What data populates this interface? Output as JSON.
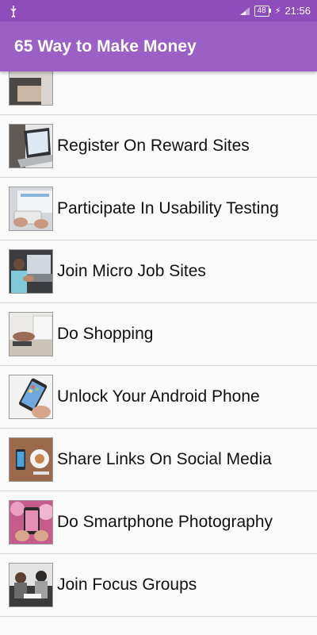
{
  "status_bar": {
    "battery": "48",
    "time": "21:56",
    "icons": [
      "usb-icon",
      "signal-icon",
      "charging-bolt-icon"
    ]
  },
  "app_bar": {
    "title": "65 Way to Make Money"
  },
  "list": {
    "items": [
      {
        "label": "",
        "thumb": "partial-item-thumbnail"
      },
      {
        "label": "Register On Reward Sites",
        "thumb": "laptop-thumbnail"
      },
      {
        "label": "Participate In Usability Testing",
        "thumb": "usability-testing-thumbnail"
      },
      {
        "label": "Join Micro Job Sites",
        "thumb": "micro-job-thumbnail"
      },
      {
        "label": "Do Shopping",
        "thumb": "shopping-thumbnail"
      },
      {
        "label": "Unlock Your Android Phone",
        "thumb": "android-phone-thumbnail"
      },
      {
        "label": "Share Links On Social Media",
        "thumb": "social-media-thumbnail"
      },
      {
        "label": "Do Smartphone Photography",
        "thumb": "smartphone-photography-thumbnail"
      },
      {
        "label": "Join Focus Groups",
        "thumb": "focus-groups-thumbnail"
      }
    ]
  }
}
